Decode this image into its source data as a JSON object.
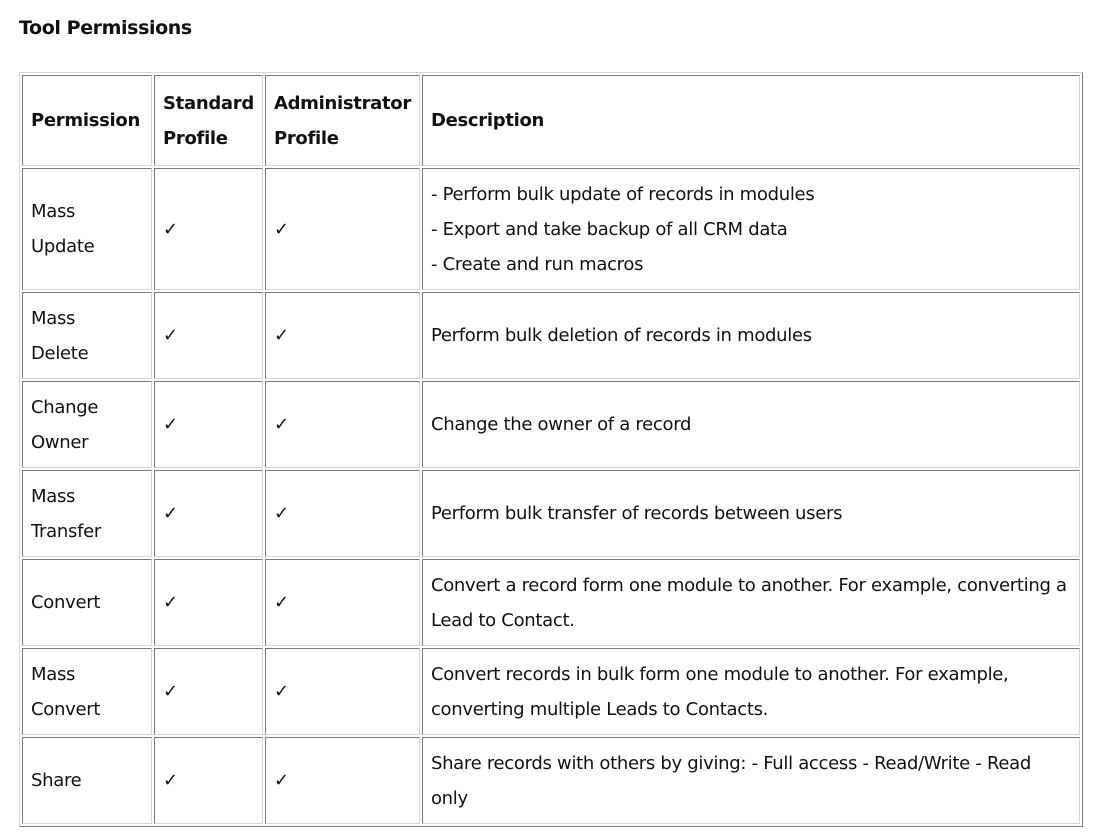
{
  "title": "Tool Permissions",
  "table": {
    "headers": {
      "permission": "Permission",
      "standard_line1": "Standard",
      "standard_line2": "Profile",
      "admin_line1": "Administrator",
      "admin_line2": "Profile",
      "description": "Description"
    },
    "check_glyph": "✓",
    "rows": [
      {
        "permission_line1": "Mass",
        "permission_line2": "Update",
        "standard": true,
        "administrator": true,
        "description_lines": [
          "- Perform bulk update of records in modules",
          "- Export and take backup of all CRM data",
          "- Create and run macros"
        ]
      },
      {
        "permission_line1": "Mass",
        "permission_line2": "Delete",
        "standard": true,
        "administrator": true,
        "description_lines": [
          "Perform bulk deletion of records in modules"
        ]
      },
      {
        "permission_line1": "Change",
        "permission_line2": "Owner",
        "standard": true,
        "administrator": true,
        "description_lines": [
          "Change the owner of a record"
        ]
      },
      {
        "permission_line1": "Mass",
        "permission_line2": "Transfer",
        "standard": true,
        "administrator": true,
        "description_lines": [
          "Perform bulk transfer of records between users"
        ]
      },
      {
        "permission_line1": "Convert",
        "permission_line2": "",
        "standard": true,
        "administrator": true,
        "description_lines": [
          "Convert a record form one module to another. For example, converting a Lead to Contact."
        ]
      },
      {
        "permission_line1": "Mass",
        "permission_line2": "Convert",
        "standard": true,
        "administrator": true,
        "description_lines": [
          "Convert records in bulk form one module to another. For example, converting multiple Leads to Contacts."
        ]
      },
      {
        "permission_line1": "Share",
        "permission_line2": "",
        "standard": true,
        "administrator": true,
        "description_lines": [
          "Share records with others by giving: - Full access - Read/Write - Read only"
        ]
      }
    ]
  }
}
